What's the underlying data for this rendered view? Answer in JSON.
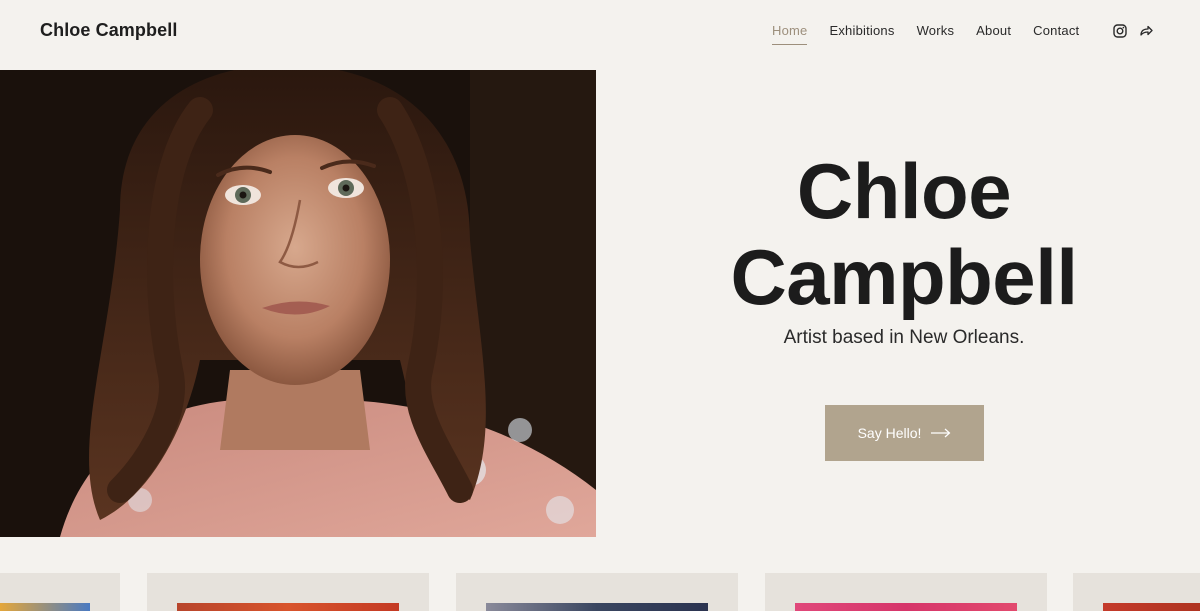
{
  "header": {
    "brand": "Chloe Campbell",
    "nav": [
      {
        "label": "Home",
        "active": true
      },
      {
        "label": "Exhibitions",
        "active": false
      },
      {
        "label": "Works",
        "active": false
      },
      {
        "label": "About",
        "active": false
      },
      {
        "label": "Contact",
        "active": false
      }
    ],
    "social_icons": [
      "instagram-icon",
      "share-icon"
    ]
  },
  "hero": {
    "title_line1": "Chloe",
    "title_line2": "Campbell",
    "subtitle": "Artist based in New Orleans.",
    "cta_label": "Say Hello!",
    "cta_icon": "arrow-right-icon",
    "photo": "portrait-photo"
  },
  "gallery": {
    "items": [
      "artwork-1",
      "artwork-2",
      "artwork-3",
      "artwork-4",
      "artwork-5"
    ]
  },
  "colors": {
    "background": "#f4f2ee",
    "accent": "#b1a48e",
    "nav_active": "#9d8f7c",
    "card_background": "#e6e2dc",
    "text": "#1c1c1c"
  }
}
